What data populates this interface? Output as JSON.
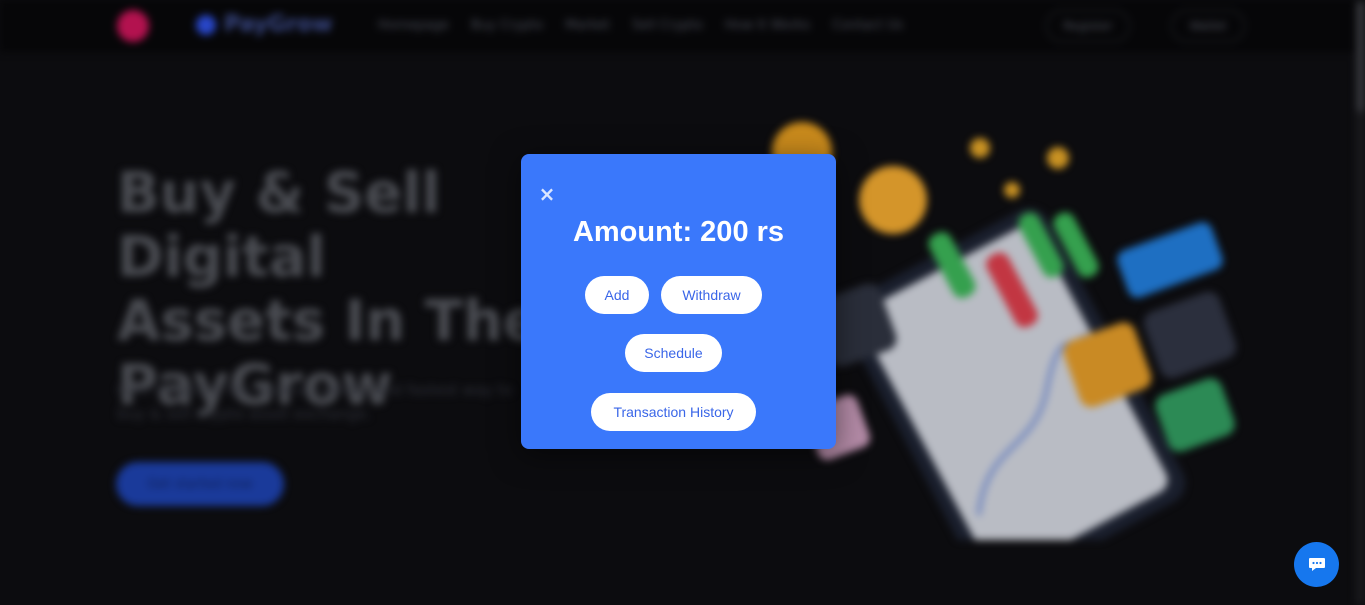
{
  "site": {
    "brand": "PayGrow",
    "nav": [
      "Homepage",
      "Buy Crypto",
      "Market",
      "Sell Crypto",
      "How It Works",
      "Contact Us"
    ],
    "register_label": "Register",
    "wallet_label": "Wallet",
    "hero_title": "Buy & Sell Digital\nAssets In The\nPayGrow",
    "hero_subtitle": "Coin Crypto is the easiest, safest, and fastest way to buy & sell crypto asset exchange.",
    "cta_label": "Get started now"
  },
  "modal": {
    "close_glyph": "×",
    "amount_text": "Amount: 200 rs",
    "buttons": {
      "add": "Add",
      "withdraw": "Withdraw",
      "schedule": "Schedule",
      "history": "Transaction History"
    }
  },
  "colors": {
    "modal_bg": "#3a78fb",
    "pill_text": "#3a66e8",
    "chat_button": "#1677ee"
  },
  "icons": {
    "close": "close-icon",
    "chat": "chat-icon"
  }
}
